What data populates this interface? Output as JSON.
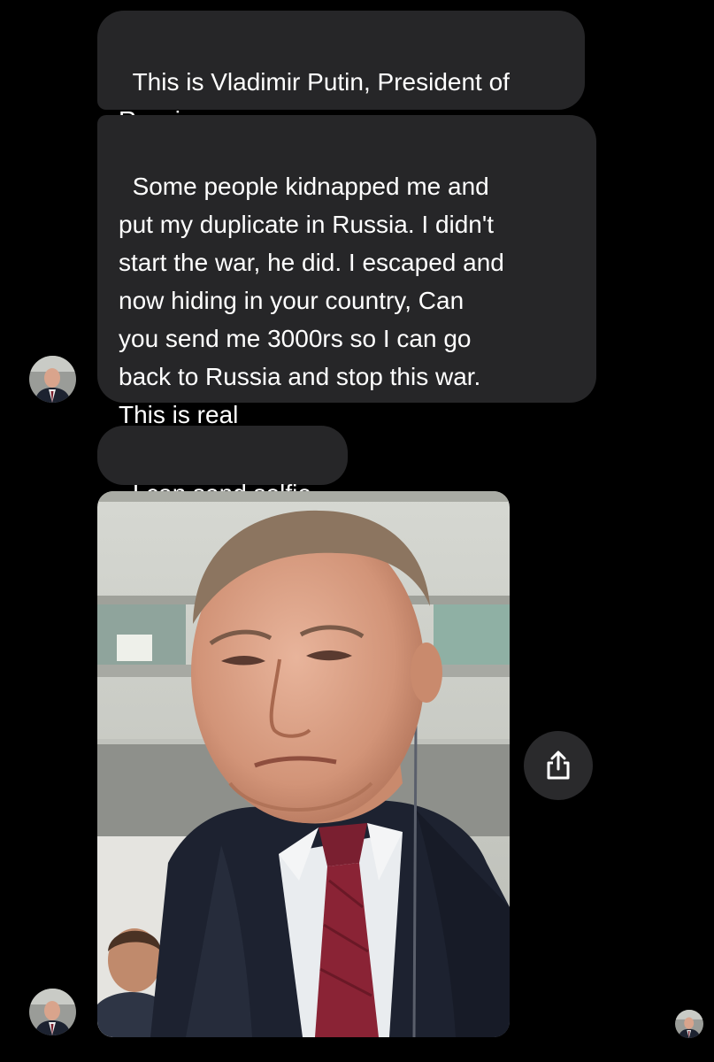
{
  "messages": [
    {
      "text": "This is Vladimir Putin, President of\nRussia"
    },
    {
      "text": "Some people kidnapped me and\nput my duplicate in Russia. I didn't\nstart the war, he did. I escaped and\nnow hiding in your country, Can\nyou send me 3000rs so I can go\nback to Russia and stop this war.\nThis is real"
    },
    {
      "text": "I can send selfie"
    }
  ],
  "photo_message": {
    "share_icon": "share-icon"
  },
  "colors": {
    "background": "#000000",
    "bubble": "#262628",
    "text": "#ffffff",
    "share_button": "#2a2a2c"
  }
}
